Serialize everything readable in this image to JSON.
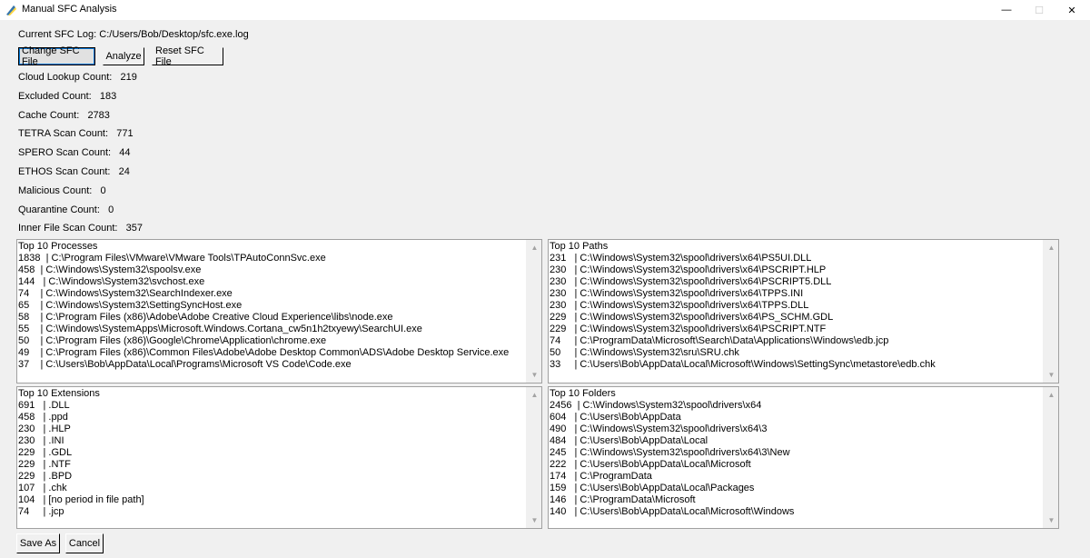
{
  "window": {
    "title": "Manual SFC Analysis",
    "icon": "python-feather-icon",
    "minimize_glyph": "—",
    "maximize_glyph": "☐",
    "close_glyph": "✕"
  },
  "log": {
    "label": "Current SFC Log:",
    "path": "C:/Users/Bob/Desktop/sfc.exe.log"
  },
  "toolbar": {
    "change_label": "Change SFC File",
    "analyze_label": "Analyze",
    "reset_label": "Reset SFC File"
  },
  "stats": [
    {
      "label": "Cloud Lookup Count:",
      "value": "219"
    },
    {
      "label": "Excluded Count:",
      "value": "183"
    },
    {
      "label": "Cache Count:",
      "value": "2783"
    },
    {
      "label": "TETRA Scan Count:",
      "value": "771"
    },
    {
      "label": "SPERO Scan Count:",
      "value": "44"
    },
    {
      "label": "ETHOS Scan Count:",
      "value": "24"
    },
    {
      "label": "Malicious Count:",
      "value": "0"
    },
    {
      "label": "Quarantine Count:",
      "value": "0"
    },
    {
      "label": "Inner File Scan Count:",
      "value": "357"
    }
  ],
  "panels": {
    "processes": {
      "title": "Top 10 Processes",
      "rows": [
        "1838  | C:\\Program Files\\VMware\\VMware Tools\\TPAutoConnSvc.exe",
        "458  | C:\\Windows\\System32\\spoolsv.exe",
        "144   | C:\\Windows\\System32\\svchost.exe",
        "74    | C:\\Windows\\System32\\SearchIndexer.exe",
        "65    | C:\\Windows\\System32\\SettingSyncHost.exe",
        "58    | C:\\Program Files (x86)\\Adobe\\Adobe Creative Cloud Experience\\libs\\node.exe",
        "55    | C:\\Windows\\SystemApps\\Microsoft.Windows.Cortana_cw5n1h2txyewy\\SearchUI.exe",
        "50    | C:\\Program Files (x86)\\Google\\Chrome\\Application\\chrome.exe",
        "49    | C:\\Program Files (x86)\\Common Files\\Adobe\\Adobe Desktop Common\\ADS\\Adobe Desktop Service.exe",
        "37    | C:\\Users\\Bob\\AppData\\Local\\Programs\\Microsoft VS Code\\Code.exe"
      ]
    },
    "paths": {
      "title": "Top 10 Paths",
      "rows": [
        "231   | C:\\Windows\\System32\\spool\\drivers\\x64\\PS5UI.DLL",
        "230   | C:\\Windows\\System32\\spool\\drivers\\x64\\PSCRIPT.HLP",
        "230   | C:\\Windows\\System32\\spool\\drivers\\x64\\PSCRIPT5.DLL",
        "230   | C:\\Windows\\System32\\spool\\drivers\\x64\\TPPS.INI",
        "230   | C:\\Windows\\System32\\spool\\drivers\\x64\\TPPS.DLL",
        "229   | C:\\Windows\\System32\\spool\\drivers\\x64\\PS_SCHM.GDL",
        "229   | C:\\Windows\\System32\\spool\\drivers\\x64\\PSCRIPT.NTF",
        "74     | C:\\ProgramData\\Microsoft\\Search\\Data\\Applications\\Windows\\edb.jcp",
        "50     | C:\\Windows\\System32\\sru\\SRU.chk",
        "33     | C:\\Users\\Bob\\AppData\\Local\\Microsoft\\Windows\\SettingSync\\metastore\\edb.chk"
      ]
    },
    "extensions": {
      "title": "Top 10 Extensions",
      "rows": [
        "691   | .DLL",
        "458   | .ppd",
        "230   | .HLP",
        "230   | .INI",
        "229   | .GDL",
        "229   | .NTF",
        "229   | .BPD",
        "107   | .chk",
        "104   | [no period in file path]",
        "74     | .jcp"
      ]
    },
    "folders": {
      "title": "Top 10 Folders",
      "rows": [
        "2456  | C:\\Windows\\System32\\spool\\drivers\\x64",
        "604   | C:\\Users\\Bob\\AppData",
        "490   | C:\\Windows\\System32\\spool\\drivers\\x64\\3",
        "484   | C:\\Users\\Bob\\AppData\\Local",
        "245   | C:\\Windows\\System32\\spool\\drivers\\x64\\3\\New",
        "222   | C:\\Users\\Bob\\AppData\\Local\\Microsoft",
        "174   | C:\\ProgramData",
        "159   | C:\\Users\\Bob\\AppData\\Local\\Packages",
        "146   | C:\\ProgramData\\Microsoft",
        "140   | C:\\Users\\Bob\\AppData\\Local\\Microsoft\\Windows"
      ]
    }
  },
  "footer": {
    "save_label": "Save As",
    "cancel_label": "Cancel"
  }
}
